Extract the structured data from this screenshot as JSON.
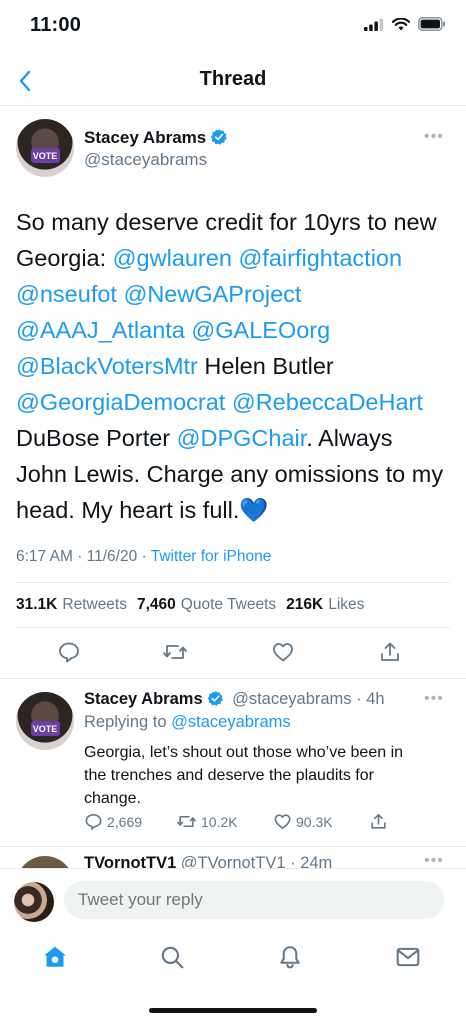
{
  "status_bar": {
    "time": "11:00"
  },
  "nav": {
    "title": "Thread"
  },
  "main_tweet": {
    "author_name": "Stacey Abrams",
    "author_handle": "@staceyabrams",
    "avatar_label": "VOTE",
    "text_segments": [
      {
        "t": "So many deserve credit for 10yrs to new Georgia: ",
        "mention": false
      },
      {
        "t": "@gwlauren",
        "mention": true
      },
      {
        "t": " ",
        "mention": false
      },
      {
        "t": "@fairfightaction",
        "mention": true
      },
      {
        "t": " ",
        "mention": false
      },
      {
        "t": "@nseufot",
        "mention": true
      },
      {
        "t": " ",
        "mention": false
      },
      {
        "t": "@NewGAProject",
        "mention": true
      },
      {
        "t": " ",
        "mention": false
      },
      {
        "t": "@AAAJ_Atlanta",
        "mention": true
      },
      {
        "t": " ",
        "mention": false
      },
      {
        "t": "@GALEOorg",
        "mention": true
      },
      {
        "t": " ",
        "mention": false
      },
      {
        "t": "@BlackVotersMtr",
        "mention": true
      },
      {
        "t": " Helen Butler ",
        "mention": false
      },
      {
        "t": "@GeorgiaDemocrat",
        "mention": true
      },
      {
        "t": " ",
        "mention": false
      },
      {
        "t": "@RebeccaDeHart",
        "mention": true
      },
      {
        "t": " DuBose Porter ",
        "mention": false
      },
      {
        "t": "@DPGChair",
        "mention": true
      },
      {
        "t": ". Always John Lewis. Charge any omissions to my head. My heart is full.💙",
        "mention": false
      }
    ],
    "time": "6:17 AM",
    "date": "11/6/20",
    "source": "Twitter for iPhone",
    "retweets_count": "31.1K",
    "retweets_label": "Retweets",
    "quotes_count": "7,460",
    "quotes_label": "Quote Tweets",
    "likes_count": "216K",
    "likes_label": "Likes"
  },
  "reply_tweet": {
    "author_name": "Stacey Abrams",
    "author_handle": "@staceyabrams",
    "age": "4h",
    "replying_to_label": "Replying to",
    "replying_to_handle": "@staceyabrams",
    "text": "Georgia, let’s shout out those who’ve been in the trenches and deserve the plaudits for change.",
    "replies": "2,669",
    "retweets": "10.2K",
    "likes": "90.3K"
  },
  "next_tweet": {
    "author_name": "TVornotTV1",
    "author_handle": "@TVornotTV1",
    "age": "24m"
  },
  "compose": {
    "placeholder": "Tweet your reply"
  },
  "colors": {
    "accent": "#1d9bf0",
    "verified": "#1d9bf0",
    "muted": "#657786"
  },
  "tabbar": {
    "icons": [
      "home-icon",
      "search-icon",
      "notifications-icon",
      "messages-icon"
    ]
  }
}
